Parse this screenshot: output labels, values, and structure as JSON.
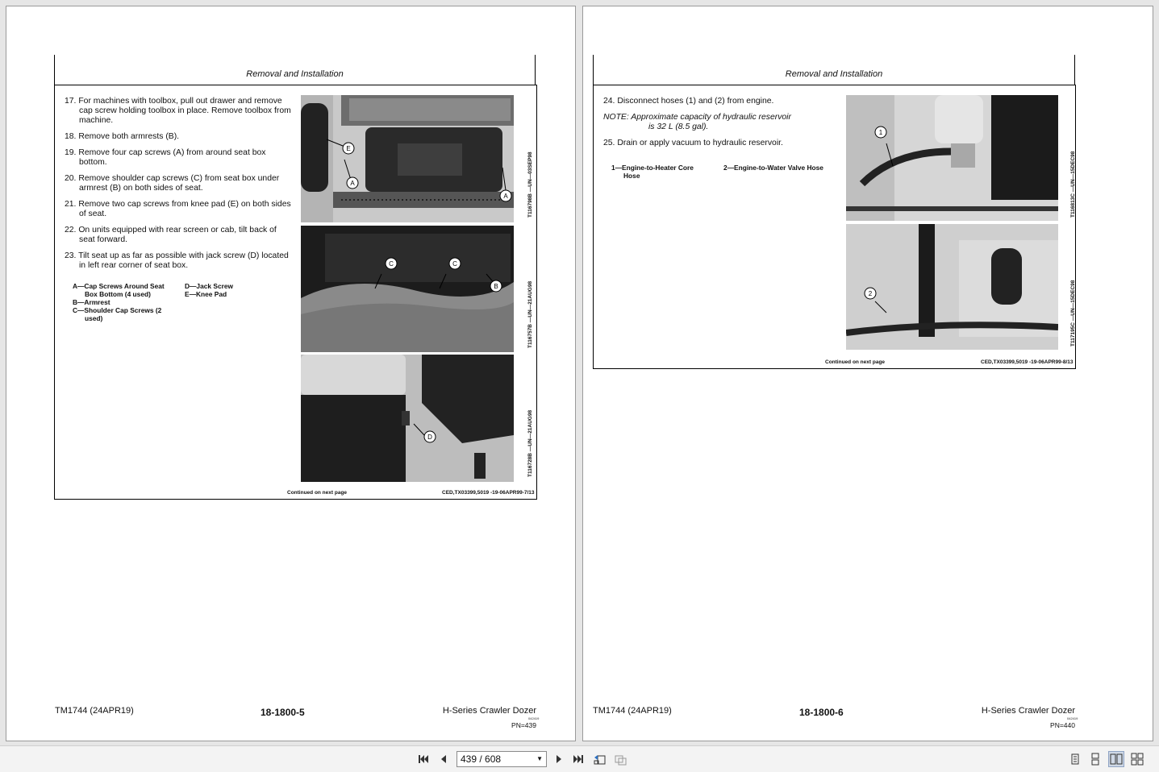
{
  "left_page": {
    "section_title": "Removal and Installation",
    "steps": [
      "17. For machines with toolbox, pull out drawer and remove cap screw holding toolbox in place. Remove toolbox from machine.",
      "18.  Remove both armrests (B).",
      "19.  Remove four cap screws (A) from around seat box bottom.",
      "20. Remove shoulder cap screws (C) from seat box under armrest (B) on both sides of seat.",
      "21. Remove two cap screws from knee pad (E) on both sides of seat.",
      "22. On units equipped with rear screen or cab, tilt back of seat forward.",
      "23. Tilt seat up as far as possible with jack screw (D) located in left rear corner of seat box."
    ],
    "legend": {
      "col1": [
        "A—Cap Screws Around Seat Box Bottom (4 used)",
        "B—Armrest",
        "C—Shoulder Cap Screws (2 used)"
      ],
      "col2": [
        "D—Jack Screw",
        "E—Knee Pad"
      ]
    },
    "figures": [
      {
        "id": "T116798B —UN—03SEP98",
        "callouts": [
          "E",
          "A",
          "A"
        ]
      },
      {
        "id": "T116757B —UN—21AUG98",
        "callouts": [
          "C",
          "C",
          "B"
        ]
      },
      {
        "id": "T116728B —UN—21AUG98",
        "callouts": [
          "D"
        ]
      }
    ],
    "continued": "Continued on next page",
    "ref_code": "CED,TX03399,5019 -19-06APR99-7/13",
    "footer": {
      "manual": "TM1744 (24APR19)",
      "page_no": "18-1800-5",
      "product": "H-Series Crawler Dozer",
      "tiny": "042419",
      "pn": "PN=439"
    }
  },
  "right_page": {
    "section_title": "Removal and Installation",
    "step24": "24. Disconnect hoses (1) and (2) from engine.",
    "note_label": "NOTE:",
    "note_line1": "Approximate capacity of hydraulic reservoir",
    "note_line2": "is 32 L (8.5 gal).",
    "step25": "25. Drain or apply vacuum to hydraulic reservoir.",
    "legend": {
      "col1": [
        "1—Engine-to-Heater Core Hose"
      ],
      "col2": [
        "2—Engine-to-Water Valve Hose"
      ]
    },
    "figures": [
      {
        "id": "T116813C —UN—15DEC98",
        "callouts": [
          "1"
        ]
      },
      {
        "id": "T117195C —UN—15DEC98",
        "callouts": [
          "2"
        ]
      }
    ],
    "continued": "Continued on next page",
    "ref_code": "CED,TX03399,5019 -19-06APR99-8/13",
    "footer": {
      "manual": "TM1744 (24APR19)",
      "page_no": "18-1800-6",
      "product": "H-Series Crawler Dozer",
      "tiny": "042419",
      "pn": "PN=440"
    }
  },
  "toolbar": {
    "page_indicator": "439 / 608",
    "icons": [
      "first-page-icon",
      "previous-page-icon",
      "next-page-icon",
      "last-page-icon",
      "go-back-icon",
      "go-forward-icon",
      "single-page-view-icon",
      "continuous-view-icon",
      "two-page-view-icon",
      "two-page-continuous-view-icon"
    ]
  }
}
